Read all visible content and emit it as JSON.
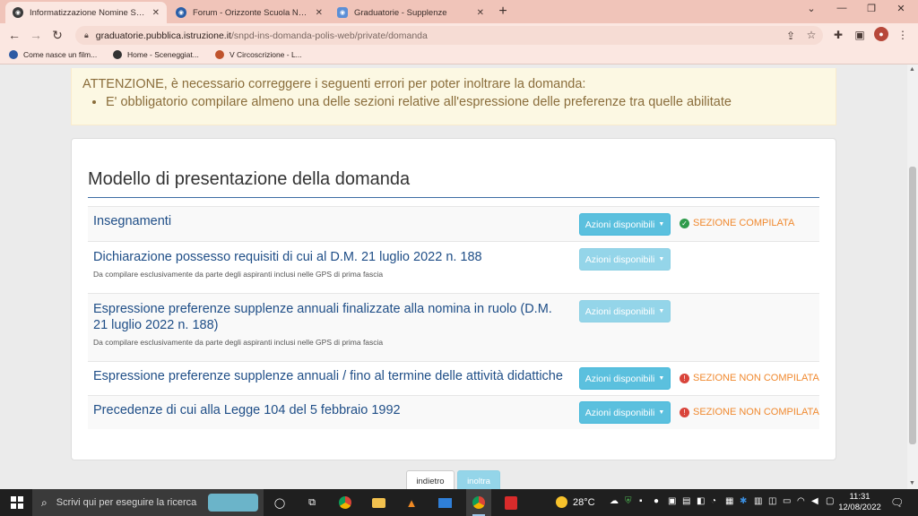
{
  "browser": {
    "tabs": [
      {
        "label": "Informatizzazione Nomine Supplenze",
        "active": true
      },
      {
        "label": "Forum - Orizzonte Scuola Notizie",
        "active": false
      },
      {
        "label": "Graduatorie - Supplenze",
        "active": false
      }
    ],
    "url_host": "graduatorie.pubblica.istruzione.it",
    "url_path": "/snpd-ins-domanda-polis-web/private/domanda",
    "bookmarks": [
      "Come nasce un film...",
      "Home - Sceneggiat...",
      "V Circoscrizione - L..."
    ],
    "profile_initial": "●"
  },
  "alert": {
    "title": "ATTENZIONE, è necessario correggere i seguenti errori per poter inoltrare la domanda:",
    "items": [
      "E' obbligatorio compilare almeno una delle sezioni relative all'espressione delle preferenze tra quelle abilitate"
    ]
  },
  "panel": {
    "title": "Modello di presentazione della domanda",
    "action_label": "Azioni disponibili",
    "rows": [
      {
        "title": "Insegnamenti",
        "subtitle": "",
        "status": "SEZIONE COMPILATA"
      },
      {
        "title": "Dichiarazione possesso requisiti di cui al D.M. 21 luglio 2022 n. 188",
        "subtitle": "Da compilare esclusivamente da parte degli aspiranti inclusi nelle GPS di prima fascia",
        "status": ""
      },
      {
        "title": "Espressione preferenze supplenze annuali finalizzate alla nomina in ruolo (D.M. 21 luglio 2022 n. 188)",
        "subtitle": "Da compilare esclusivamente da parte degli aspiranti inclusi nelle GPS di prima fascia",
        "status": ""
      },
      {
        "title": "Espressione preferenze supplenze annuali / fino al termine delle attività didattiche",
        "subtitle": "",
        "status": "SEZIONE NON COMPILATA"
      },
      {
        "title": "Precedenze di cui alla Legge 104 del 5 febbraio 1992",
        "subtitle": "",
        "status": "SEZIONE NON COMPILATA"
      }
    ]
  },
  "footer": {
    "back_label": "indietro",
    "send_label": "inoltra"
  },
  "taskbar": {
    "search_placeholder": "Scrivi qui per eseguire la ricerca",
    "temperature": "28°C",
    "time": "11:31",
    "date": "12/08/2022"
  },
  "colors": {
    "completed": "#f0892f",
    "not_completed": "#f0892f",
    "ok_icon": "#2e9b4b",
    "error_icon": "#d9443a"
  }
}
